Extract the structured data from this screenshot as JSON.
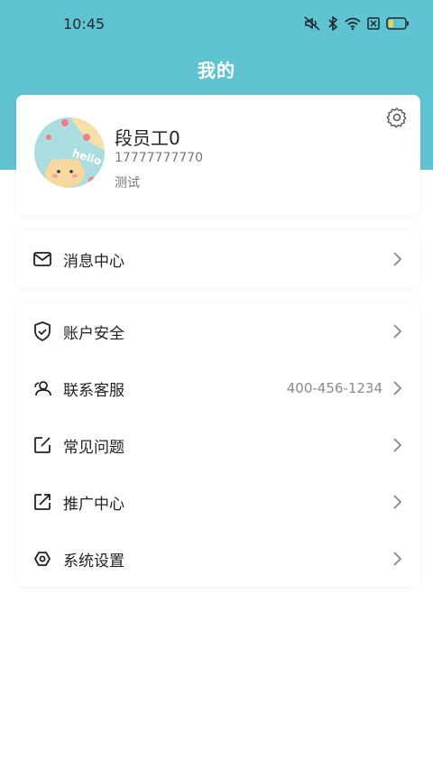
{
  "status_bar": {
    "time": "10:45",
    "icons": [
      "mute-icon",
      "bluetooth-icon",
      "wifi-icon",
      "sim-card-icon",
      "battery-icon"
    ],
    "battery_level": 0.3
  },
  "header": {
    "title": "我的",
    "bg_color": "#60c3d2"
  },
  "profile": {
    "name": "段员工0",
    "phone": "17777777770",
    "role": "测试",
    "avatar_text": "hello"
  },
  "message_center": {
    "label": "消息中心"
  },
  "menu": {
    "items": [
      {
        "label": "账户安全",
        "icon": "shield-check-icon",
        "value": ""
      },
      {
        "label": "联系客服",
        "icon": "customer-service-icon",
        "value": "400-456-1234"
      },
      {
        "label": "常见问题",
        "icon": "edit-icon",
        "value": ""
      },
      {
        "label": "推广中心",
        "icon": "share-icon",
        "value": ""
      },
      {
        "label": "系统设置",
        "icon": "settings-hex-icon",
        "value": ""
      }
    ]
  }
}
